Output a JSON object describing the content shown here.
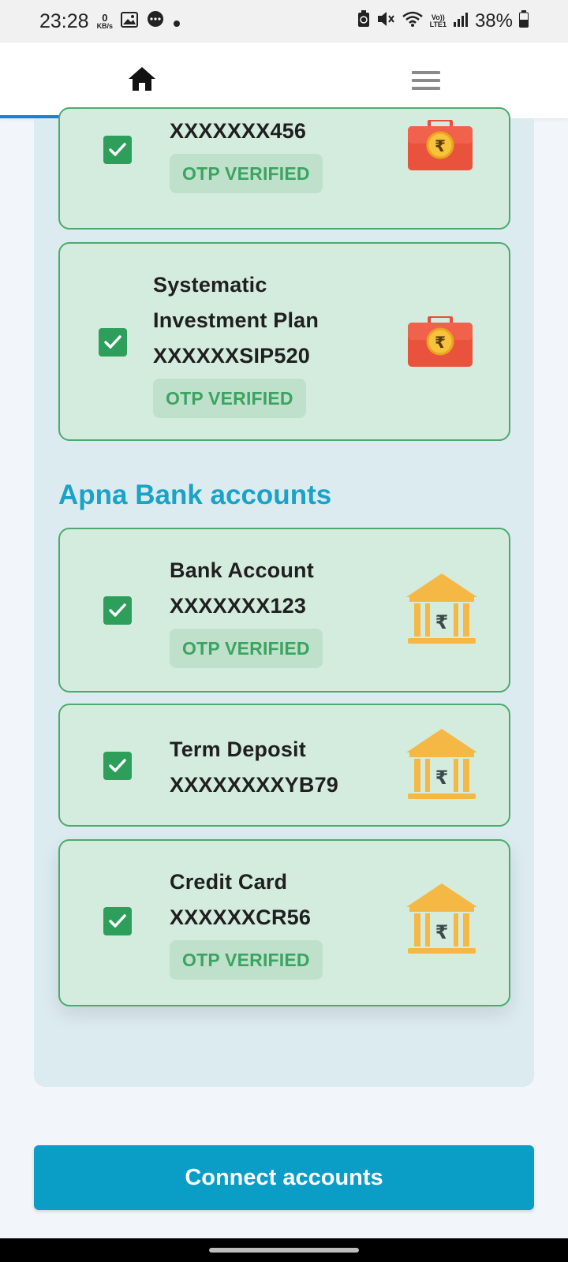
{
  "status_bar": {
    "time": "23:28",
    "net_speed_value": "0",
    "net_speed_unit": "KB/s",
    "volte": "Vo))",
    "lte": "LTE1",
    "battery": "38%"
  },
  "top_nav": {
    "home_icon": "home-icon",
    "menu_icon": "menu-icon",
    "active_tab": "home",
    "active_color": "#1a7fd6"
  },
  "section": {
    "heading": "Apna Bank accounts"
  },
  "accounts_above": [
    {
      "name": "",
      "number": "XXXXXXX456",
      "status": "OTP VERIFIED",
      "icon": "briefcase-rupee-icon"
    },
    {
      "name_line1": "Systematic",
      "name_line2": "Investment Plan",
      "number": "XXXXXXSIP520",
      "status": "OTP VERIFIED",
      "icon": "briefcase-rupee-icon"
    }
  ],
  "bank_accounts": [
    {
      "name": "Bank Account",
      "number": "XXXXXXX123",
      "status": "OTP VERIFIED",
      "icon": "bank-rupee-icon"
    },
    {
      "name": "Term Deposit",
      "number": "XXXXXXXXYB79",
      "icon": "bank-rupee-icon"
    },
    {
      "name": "Credit Card",
      "number": "XXXXXXCR56",
      "status": "OTP VERIFIED",
      "icon": "bank-rupee-icon"
    }
  ],
  "connect_button": {
    "label": "Connect accounts",
    "color": "#0a9dc6"
  },
  "colors": {
    "card_bg": "#d4ecde",
    "card_border": "#4caa6e",
    "check": "#2e9e5b",
    "badge_text": "#3aa460",
    "heading": "#1aa2c7"
  }
}
